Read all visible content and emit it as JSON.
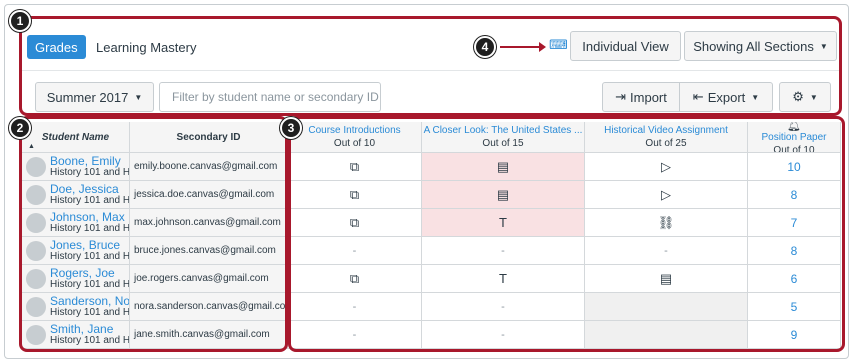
{
  "header": {
    "tabs": [
      {
        "label": "Grades",
        "active": true
      },
      {
        "label": "Learning Mastery",
        "active": false
      }
    ],
    "individual_view": "Individual View",
    "sections_label": "Showing All Sections"
  },
  "toolbar": {
    "term": "Summer 2017",
    "filter_placeholder": "Filter by student name or secondary ID",
    "import_label": "Import",
    "export_label": "Export"
  },
  "callouts": [
    "1",
    "2",
    "3",
    "4"
  ],
  "grid": {
    "student_header": "Student Name",
    "secondary_header": "Secondary ID",
    "assignments": [
      {
        "title": "Course Introductions",
        "out_of": "Out of 10"
      },
      {
        "title": "A Closer Look: The United States ...",
        "out_of": "Out of 15"
      },
      {
        "title": "Historical Video Assignment",
        "out_of": "Out of 25"
      },
      {
        "title": "Position Paper",
        "out_of": "Out of 10"
      }
    ],
    "rows": [
      {
        "name": "Boone, Emily",
        "section": "History 101 and H",
        "email": "emily.boone.canvas@gmail.com",
        "c1": "discussion-icon",
        "c2": "document-icon",
        "c3": "video-icon",
        "c4": "10"
      },
      {
        "name": "Doe, Jessica",
        "section": "History 101 and H",
        "email": "jessica.doe.canvas@gmail.com",
        "c1": "discussion-icon",
        "c2": "document-icon",
        "c3": "video-icon",
        "c4": "8"
      },
      {
        "name": "Johnson, Max",
        "section": "History 101 and H",
        "email": "max.johnson.canvas@gmail.com",
        "c1": "discussion-icon",
        "c2": "text-icon",
        "c3": "link-icon",
        "c4": "7"
      },
      {
        "name": "Jones, Bruce",
        "section": "History 101 and H",
        "email": "bruce.jones.canvas@gmail.com",
        "c1": "-",
        "c2": "-",
        "c3": "-",
        "c4": "8"
      },
      {
        "name": "Rogers, Joe",
        "section": "History 101 and H",
        "email": "joe.rogers.canvas@gmail.com",
        "c1": "discussion-icon",
        "c2": "text-icon",
        "c3": "document-icon",
        "c4": "6"
      },
      {
        "name": "Sanderson, Nor",
        "section": "History 101 and H",
        "email": "nora.sanderson.canvas@gmail.com",
        "c1": "-",
        "c2": "-",
        "c3": "",
        "c4": "5"
      },
      {
        "name": "Smith, Jane",
        "section": "History 101 and H",
        "email": "jane.smith.canvas@gmail.com",
        "c1": "-",
        "c2": "-",
        "c3": "",
        "c4": "9"
      }
    ]
  },
  "colors": {
    "accent": "#2b8bd6",
    "callout": "#a8182c",
    "late": "#f9e1e3"
  }
}
